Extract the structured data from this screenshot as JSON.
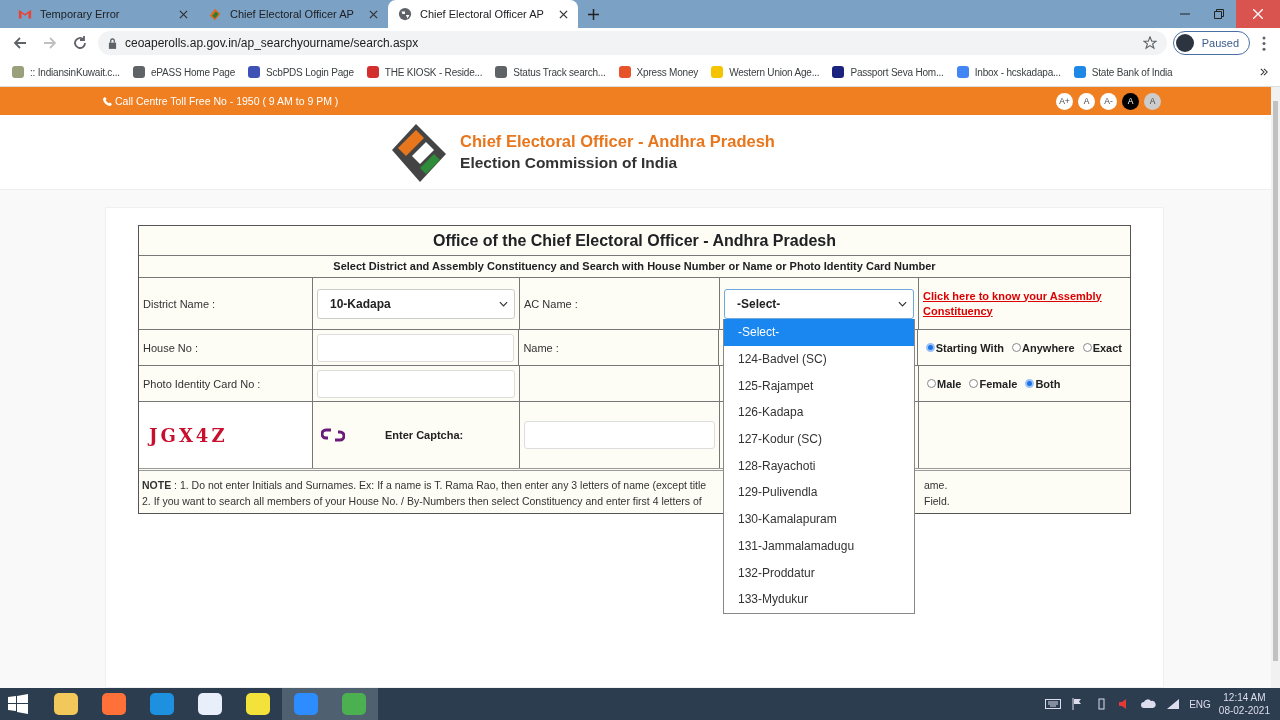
{
  "browser": {
    "tabs": [
      {
        "title": "Temporary Error",
        "selected": false,
        "kind": "mail"
      },
      {
        "title": "Chief Electoral Officer AP",
        "selected": false,
        "kind": "logo"
      },
      {
        "title": "Chief Electoral Officer AP",
        "selected": true,
        "kind": "globe"
      }
    ],
    "url": "ceoaperolls.ap.gov.in/ap_searchyourname/search.aspx",
    "profile": "Paused",
    "bookmarks": [
      {
        "label": ":: IndiansinKuwait.c...",
        "color": "#9aa07a"
      },
      {
        "label": "ePASS Home Page",
        "color": "#5f6368"
      },
      {
        "label": "ScbPDS Login Page",
        "color": "#3f51b5"
      },
      {
        "label": "THE KIOSK - Reside...",
        "color": "#d32f2f"
      },
      {
        "label": "Status Track search...",
        "color": "#5f6368"
      },
      {
        "label": "Xpress Money",
        "color": "#e8542a"
      },
      {
        "label": "Western Union Age...",
        "color": "#f5c400"
      },
      {
        "label": "Passport Seva Hom...",
        "color": "#1a237e"
      },
      {
        "label": "Inbox - hcskadapa...",
        "color": "#4285f4"
      },
      {
        "label": "State Bank of India",
        "color": "#1e88e5"
      }
    ]
  },
  "topbar": {
    "call_centre": "Call Centre Toll Free No - 1950 ( 9 AM to 9 PM )",
    "font_buttons": [
      {
        "label": "A+",
        "kind": "light"
      },
      {
        "label": "A",
        "kind": "light"
      },
      {
        "label": "A-",
        "kind": "light"
      },
      {
        "label": "A",
        "kind": "dark"
      },
      {
        "label": "A",
        "kind": "grey"
      }
    ]
  },
  "header": {
    "title": "Chief Electoral Officer - Andhra Pradesh",
    "subtitle": "Election Commission of India"
  },
  "form": {
    "title": "Office of the Chief Electoral Officer - Andhra Pradesh",
    "subtitle": "Select District and Assembly Constituency and Search with House Number or Name or Photo Identity Card Number",
    "district_label": "District Name :",
    "district_value": "10-Kadapa",
    "ac_label": "AC Name :",
    "ac_value": "-Select-",
    "ac_link": "Click here to know your Assembly Constituency",
    "house_label": "House No :",
    "name_label": "Name :",
    "search_modes": [
      {
        "label": "Starting With",
        "selected": true
      },
      {
        "label": "Anywhere",
        "selected": false
      },
      {
        "label": "Exact",
        "selected": false
      }
    ],
    "epic_label": "Photo Identity Card No :",
    "genders": [
      {
        "label": "Male",
        "selected": false
      },
      {
        "label": "Female",
        "selected": false
      },
      {
        "label": "Both",
        "selected": true
      }
    ],
    "captcha": "JGX4Z",
    "captcha_label": "Enter Captcha:",
    "note_lines": [
      {
        "left": "**NOTE** : 1. Do not enter Initials and Surnames. Ex: If a name is T. Rama Rao, then enter any 3 letters of name (except title",
        "right": "ame."
      },
      {
        "left": "2. If you want to search all members of your House No. / By-Numbers then select Constituency and enter first 4 letters of",
        "right": "Field."
      }
    ],
    "ac_options": [
      {
        "label": "-Select-",
        "selected": true
      },
      {
        "label": "124-Badvel (SC)",
        "selected": false
      },
      {
        "label": "125-Rajampet",
        "selected": false
      },
      {
        "label": "126-Kadapa",
        "selected": false
      },
      {
        "label": "127-Kodur (SC)",
        "selected": false
      },
      {
        "label": "128-Rayachoti",
        "selected": false
      },
      {
        "label": "129-Pulivendla",
        "selected": false
      },
      {
        "label": "130-Kamalapuram",
        "selected": false
      },
      {
        "label": "131-Jammalamadugu",
        "selected": false
      },
      {
        "label": "132-Proddatur",
        "selected": false
      },
      {
        "label": "133-Mydukur",
        "selected": false
      }
    ]
  },
  "taskbar": {
    "language": "ENG",
    "time": "12:14 AM",
    "date": "08-02-2021"
  }
}
